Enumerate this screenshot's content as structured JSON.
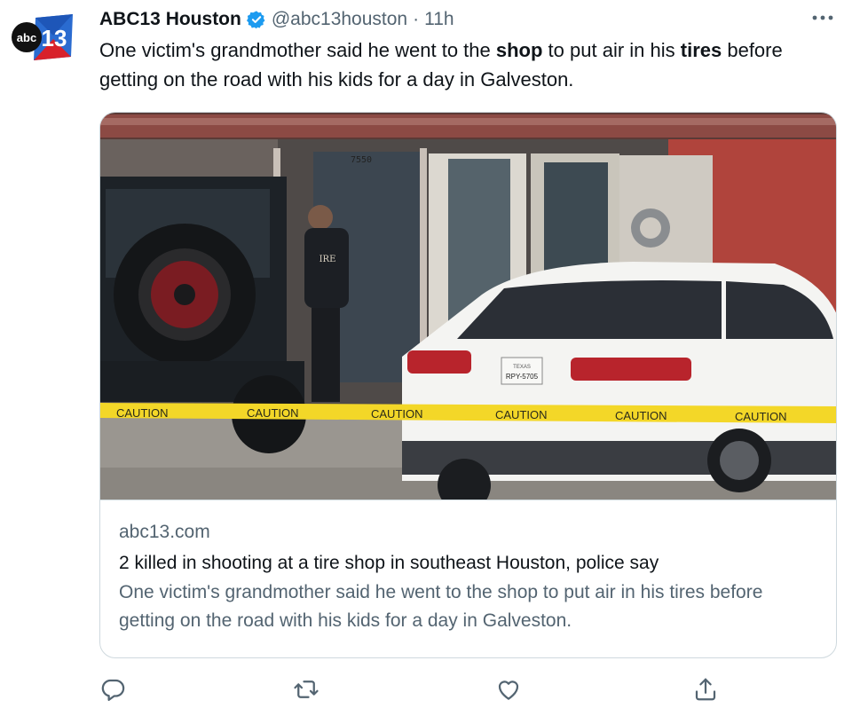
{
  "account": {
    "display_name": "ABC13 Houston",
    "handle": "@abc13houston",
    "separator": "·",
    "time": "11h",
    "avatar_text": "abc",
    "avatar_number": "13",
    "verified_color": "#1d9bf0"
  },
  "tweet": {
    "part1": "One victim's grandmother said he went to the ",
    "bold1": "shop",
    "part2": " to put air in his ",
    "bold2": "tires",
    "part3": " before getting on the road with his kids for a day in Galveston."
  },
  "card": {
    "image_texts": {
      "address": "7550",
      "shirt": "IRE",
      "plate_state": "TEXAS",
      "plate": "RPY-5705",
      "tape": [
        "CAUTION",
        "CAUTION",
        "CAUTION",
        "CAUTION",
        "CAUTION",
        "CAUTION"
      ]
    },
    "domain": "abc13.com",
    "title": "2 killed in shooting at a tire shop in southeast Houston, police say",
    "description": "One victim's grandmother said he went to the shop to put air in his tires before getting on the road with his kids for a day in Galveston."
  },
  "actions": {
    "icons": [
      "reply-icon",
      "retweet-icon",
      "like-icon",
      "share-icon"
    ]
  },
  "colors": {
    "text": "#0f1419",
    "secondary": "#536471",
    "border": "#cfd9de",
    "brand_blue": "#1d9bf0"
  }
}
